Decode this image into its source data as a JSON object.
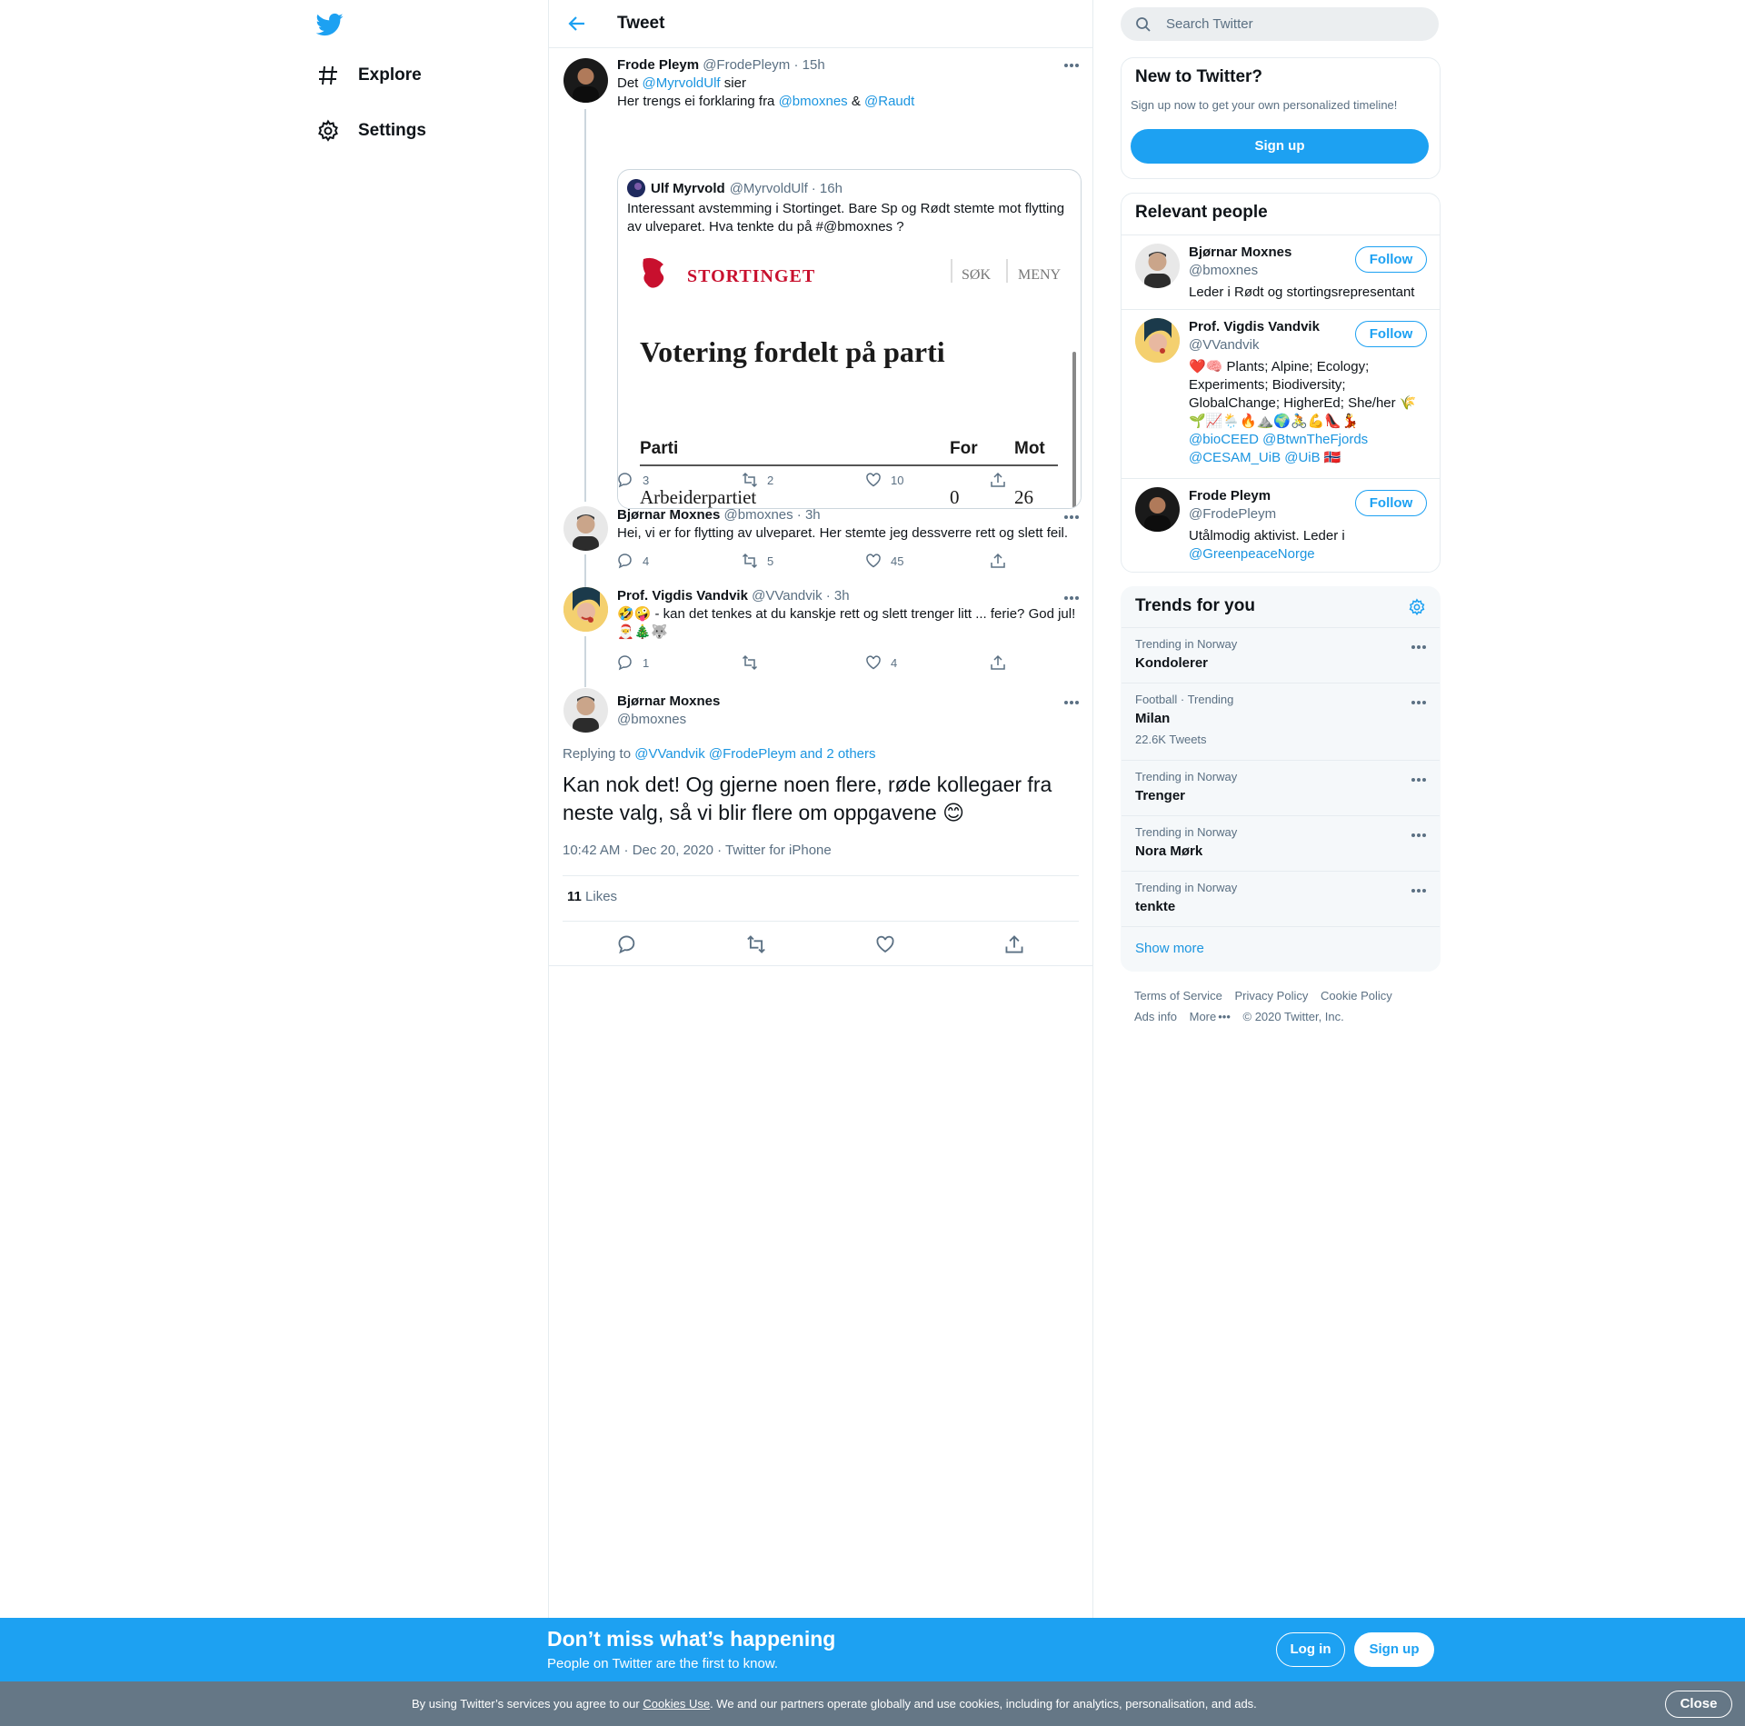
{
  "nav": {
    "items": [
      {
        "label": "Explore",
        "icon": "hashtag-icon"
      },
      {
        "label": "Settings",
        "icon": "gear-icon"
      }
    ]
  },
  "header": {
    "title": "Tweet"
  },
  "thread": {
    "root": {
      "name": "Frode Pleym",
      "handle": "@FrodePleym",
      "time": "· 15h",
      "line1_prefix": "Det",
      "line1_mention": "@MyrvoldUlf",
      "line1_suffix": "sier",
      "line2_prefix": "Her trengs ei forklaring fra",
      "mention_a": "@bmoxnes",
      "amp": "&",
      "mention_b": "@Raudt",
      "quote": {
        "name": "Ulf Myrvold",
        "handle": "@MyrvoldUlf",
        "time": "· 16h",
        "text": "Interessant avstemming i Stortinget. Bare Sp og Rødt stemte mot flytting av ulveparet. Hva tenkte du på #@bmoxnes ?",
        "media": {
          "brand": "STORTINGET",
          "sok": "SØK",
          "meny": "MENY",
          "heading": "Votering fordelt på parti",
          "col_parti": "Parti",
          "col_for": "For",
          "col_mot": "Mot",
          "row_party": "Arbeiderpartiet",
          "row_for": "0",
          "row_mot": "26"
        }
      },
      "replies": "3",
      "retweets": "2",
      "likes": "10"
    },
    "reply1": {
      "name": "Bjørnar Moxnes",
      "handle": "@bmoxnes",
      "time": "· 3h",
      "text": "Hei, vi er for flytting av ulveparet. Her stemte jeg dessverre rett og slett feil.",
      "replies": "4",
      "retweets": "5",
      "likes": "45"
    },
    "reply2": {
      "name": "Prof. Vigdis Vandvik",
      "handle": "@VVandvik",
      "time": "· 3h",
      "text_line1": "🤣🤪 - kan det tenkes at du kanskje rett og slett trenger litt ... ferie? God jul!",
      "text_line2": "🎅🎄🐺",
      "replies": "1",
      "likes": "4"
    },
    "main": {
      "name": "Bjørnar Moxnes",
      "handle": "@bmoxnes",
      "replying_label": "Replying to",
      "replying_to": "@VVandvik @FrodePleym and 2 others",
      "text": "Kan nok det! Og gjerne noen flere, røde kollegaer fra neste valg, så vi blir flere om oppgavene 😊",
      "meta": "10:42 AM · Dec 20, 2020 · Twitter for iPhone",
      "likes_count": "11",
      "likes_label": "Likes"
    }
  },
  "search": {
    "placeholder": "Search Twitter"
  },
  "new_to_twitter": {
    "title": "New to Twitter?",
    "subtitle": "Sign up now to get your own personalized timeline!",
    "signup": "Sign up"
  },
  "relevant": {
    "title": "Relevant people",
    "follow_label": "Follow",
    "people": [
      {
        "name": "Bjørnar Moxnes",
        "handle": "@bmoxnes",
        "bio": "Leder i Rødt og stortingsrepresentant"
      },
      {
        "name": "Prof. Vigdis Vandvik",
        "handle": "@VVandvik",
        "bio1": "❤️🧠 Plants; Alpine; Ecology; Experiments; Biodiversity; GlobalChange; HigherEd; She/her 🌾",
        "bio2": "🌱📈🌦️🔥⛰️🌍🚴💪👠💃",
        "links1": "@bioCEED @BtwnTheFjords",
        "links2": "@CESAM_UiB @UiB",
        "flag": "🇳🇴"
      },
      {
        "name": "Frode Pleym",
        "handle": "@FrodePleym",
        "bio": "Utålmodig aktivist. Leder i",
        "bio_link": "@GreenpeaceNorge"
      }
    ]
  },
  "trends": {
    "title": "Trends for you",
    "items": [
      {
        "category": "Trending in Norway",
        "name": "Kondolerer"
      },
      {
        "category": "Football · Trending",
        "name": "Milan",
        "count": "22.6K Tweets"
      },
      {
        "category": "Trending in Norway",
        "name": "Trenger"
      },
      {
        "category": "Trending in Norway",
        "name": "Nora Mørk"
      },
      {
        "category": "Trending in Norway",
        "name": "tenkte"
      }
    ],
    "show_more": "Show more"
  },
  "footer": {
    "links": [
      "Terms of Service",
      "Privacy Policy",
      "Cookie Policy",
      "Ads info",
      "More"
    ],
    "copyright": "© 2020 Twitter, Inc."
  },
  "bottom_bar": {
    "title": "Don’t miss what’s happening",
    "subtitle": "People on Twitter are the first to know.",
    "login": "Log in",
    "signup": "Sign up"
  },
  "cookie": {
    "prefix": "By using Twitter’s services you agree to our",
    "link": "Cookies Use",
    "suffix": ". We and our partners operate globally and use cookies, including for analytics, personalisation, and ads.",
    "close": "Close"
  },
  "colors": {
    "accent": "#1da1f2",
    "link": "#1b95e0",
    "text": "#0f1419",
    "muted": "#5b7083",
    "cookie_bg": "#657786"
  }
}
